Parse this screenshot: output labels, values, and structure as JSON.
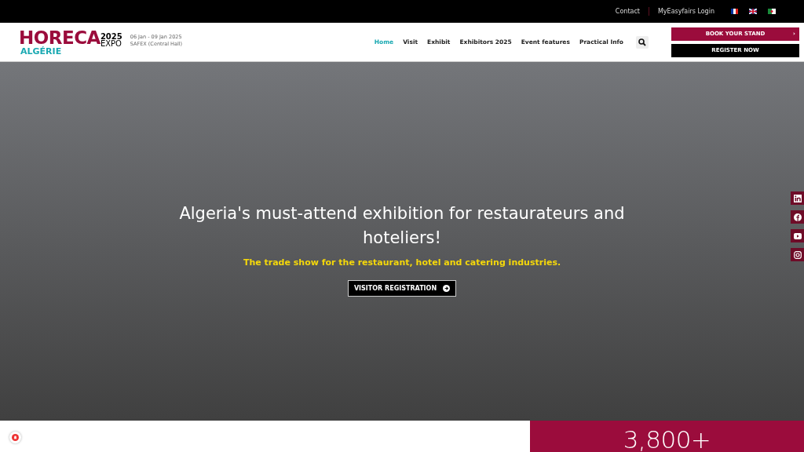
{
  "top_bar": {
    "links": [
      "Contact",
      "MyEasyfairs Login"
    ]
  },
  "header": {
    "logo": {
      "word": "HORECA",
      "year": "2025",
      "expo": "EXPO",
      "country": "ALGÉRIE"
    },
    "dates": "06 Jan - 09 Jan 2025",
    "venue": "SAFEX (Central Hall)",
    "nav": [
      {
        "label": "Home",
        "selected": true
      },
      {
        "label": "Visit",
        "selected": false
      },
      {
        "label": "Exhibit",
        "selected": false
      },
      {
        "label": "Exhibitors 2025",
        "selected": false
      },
      {
        "label": "Event features",
        "selected": false
      },
      {
        "label": "Practical Info",
        "selected": false
      }
    ],
    "buttons": [
      {
        "label": "BOOK YOUR STAND",
        "kind": "primary",
        "arrow": "›"
      },
      {
        "label": "REGISTER NOW",
        "kind": "dark"
      }
    ]
  },
  "hero": {
    "title": "Algeria's must-attend exhibition for restaurateurs and hoteliers!",
    "subtitle": "The trade show for the restaurant, hotel and catering industries.",
    "button": "VISITOR REGISTRATION"
  },
  "stats": {
    "value": "3,800+"
  }
}
